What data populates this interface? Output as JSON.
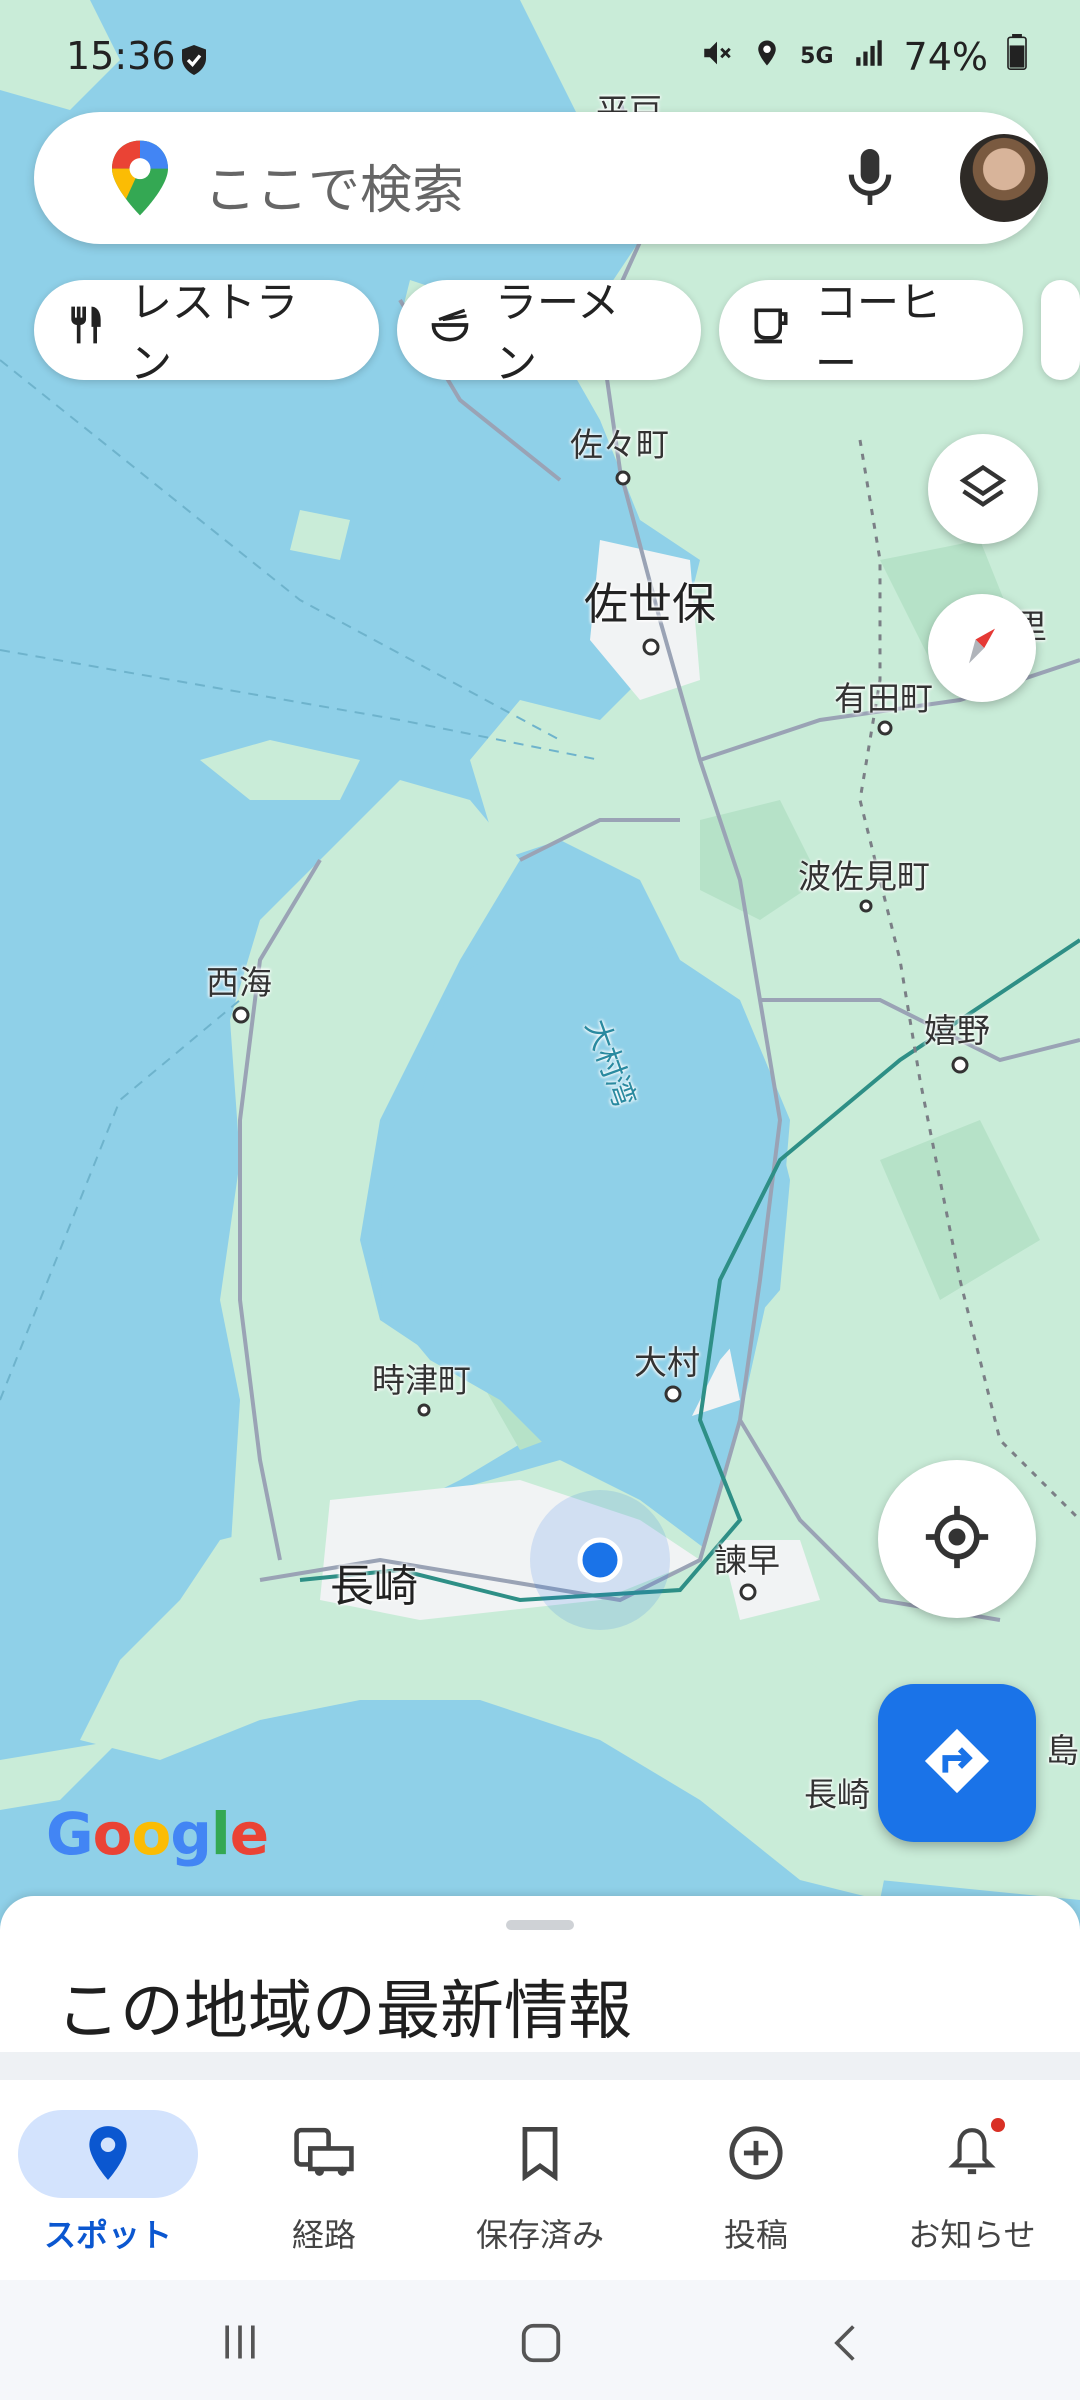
{
  "status_bar": {
    "time": "15:36",
    "network": "5G",
    "battery": "74%",
    "icons": [
      "shield-icon",
      "mute-icon",
      "location-icon",
      "data-arrows-icon",
      "signal-icon",
      "battery-icon"
    ]
  },
  "search": {
    "placeholder": "ここで検索",
    "icons": [
      "google-maps-pin-icon",
      "microphone-icon",
      "avatar"
    ]
  },
  "chips": [
    {
      "label": "レストラン",
      "icon": "fork-knife-icon"
    },
    {
      "label": "ラーメン",
      "icon": "ramen-bowl-icon"
    },
    {
      "label": "コーヒー",
      "icon": "coffee-cup-icon"
    }
  ],
  "map": {
    "places": {
      "hirado": "平戸",
      "sasa": "佐々町",
      "sasebo": "佐世保",
      "arita": "有田町",
      "hasami": "波佐見町",
      "saikai": "西海",
      "omurawan": "大村湾",
      "ureshino": "嬉野",
      "omura": "大村",
      "togitsu": "時津町",
      "nagasaki": "長崎",
      "isahaya": "諫早",
      "nagasaki_partial": "長崎",
      "shima_partial": "島",
      "sato_partial": "里"
    },
    "attribution": "Google",
    "colors": {
      "water": "#8fd0e8",
      "land": "#c9ecd8",
      "urban": "#f1f3f4",
      "road": "#9aa3b5",
      "rail": "#2e8f86",
      "accent": "#1a73e8"
    }
  },
  "controls": {
    "layers": "layers-icon",
    "compass": "compass-icon",
    "my_location": "my-location-icon",
    "directions": "directions-icon"
  },
  "sheet": {
    "title": "この地域の最新情報"
  },
  "nav": {
    "items": [
      {
        "label": "スポット",
        "icon": "location-pin-icon",
        "active": true
      },
      {
        "label": "経路",
        "icon": "commute-icon",
        "active": false
      },
      {
        "label": "保存済み",
        "icon": "bookmark-icon",
        "active": false
      },
      {
        "label": "投稿",
        "icon": "add-circle-icon",
        "active": false
      },
      {
        "label": "お知らせ",
        "icon": "bell-icon",
        "active": false
      }
    ]
  }
}
